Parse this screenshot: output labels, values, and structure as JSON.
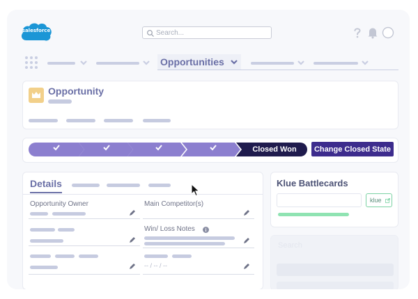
{
  "header": {
    "logo_text": "salesforce",
    "search_placeholder": "Search...",
    "icons": [
      "help-icon",
      "bell-icon",
      "avatar"
    ]
  },
  "nav": {
    "active_tab": "Opportunities"
  },
  "opportunity": {
    "title": "Opportunity"
  },
  "path": {
    "stages_completed": 4,
    "current_stage": "Closed Won",
    "change_button": "Change Closed State"
  },
  "details": {
    "tab_label": "Details",
    "fields": [
      {
        "label": "Opportunity Owner"
      },
      {
        "label": "Main Competitor(s)"
      },
      {
        "label": "Win/ Loss Notes"
      }
    ],
    "date_placeholder": "-- / -- / --"
  },
  "klue": {
    "title": "Klue Battlecards",
    "button_label": "klue"
  },
  "faded": {
    "label": "Search"
  },
  "colors": {
    "stage_completed": "#8c7fcf",
    "stage_current": "#1f1b4d",
    "button": "#3d2c8d",
    "accent_text": "#6a6fa6",
    "klue_green": "#7ad2a3"
  }
}
